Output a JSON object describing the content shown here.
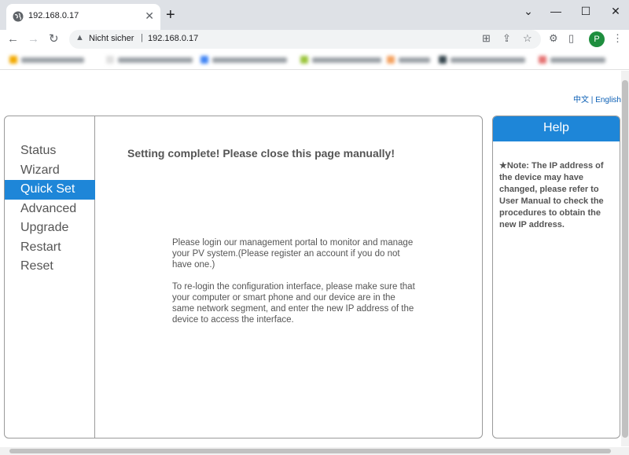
{
  "browser": {
    "tab_title": "192.168.0.17",
    "tab_close": "✕",
    "new_tab": "+",
    "window_minimize": "⌄",
    "window_min": "—",
    "window_max": "☐",
    "window_close": "✕",
    "nav_back": "←",
    "nav_forward": "→",
    "nav_reload": "↻",
    "security_text": "Nicht sicher",
    "url": "192.168.0.17",
    "profile_initial": "P"
  },
  "page": {
    "lang_zh": "中文",
    "lang_sep": "|",
    "lang_en": "English",
    "menu": [
      {
        "label": "Status"
      },
      {
        "label": "Wizard"
      },
      {
        "label": "Quick Set"
      },
      {
        "label": "Advanced"
      },
      {
        "label": "Upgrade"
      },
      {
        "label": "Restart"
      },
      {
        "label": "Reset"
      }
    ],
    "complete_message": "Setting complete! Please close this page manually!",
    "paragraph1": "Please login our management portal to monitor and manage your PV system.(Please register an account if you do not have one.)",
    "paragraph2": "To re-login the configuration interface, please make sure that your computer or smart phone and our device are in the same network segment, and enter the new IP address of the device to access the interface.",
    "help_title": "Help",
    "help_note": "★Note: The IP address of the device may have changed, please refer to User Manual to check the procedures to obtain the new IP address."
  },
  "colors": {
    "accent": "#1e86d8",
    "text": "#555555"
  }
}
